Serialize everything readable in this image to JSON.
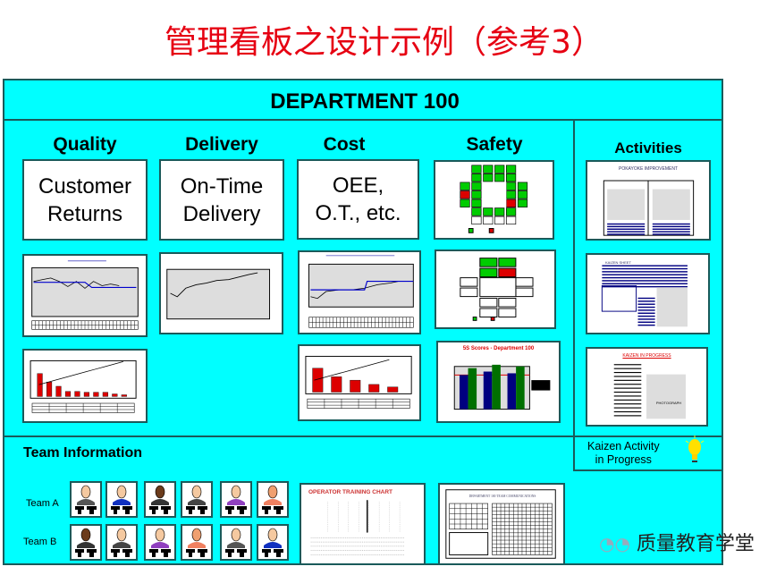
{
  "slide_title": "管理看板之设计示例（参考3）",
  "board": {
    "header": "DEPARTMENT 100",
    "categories": [
      {
        "label": "Quality",
        "kpi": "Customer\nReturns"
      },
      {
        "label": "Delivery",
        "kpi": "On-Time\nDelivery"
      },
      {
        "label": "Cost",
        "kpi": "OEE,\nO.T., etc."
      },
      {
        "label": "Safety"
      }
    ],
    "activities": {
      "label": "Activities",
      "thumbs": [
        "POKAYOKE IMPROVEMENT",
        "KAIZEN SHEET",
        "KAIZEN IN PROGRESS"
      ],
      "photo_label": "PHOTOGRAPH",
      "kaizen_note": "Kaizen Activity\nin Progress",
      "bulb_icon": "lightbulb-icon"
    },
    "five_s_title": "5S Scores - Department 100",
    "team_info": {
      "label": "Team Information",
      "teams": [
        "Team A",
        "Team B"
      ],
      "training_chart_title": "OPERATOR TRAINING CHART",
      "communications_title": "DEPARTMENT 100 TEAM COMMUNICATIONS"
    }
  },
  "watermark": "质量教育学堂",
  "colors": {
    "title": "#e60012",
    "board": "#00ffff",
    "green": "#00cc00",
    "red": "#dd0000",
    "navy": "#000080"
  }
}
